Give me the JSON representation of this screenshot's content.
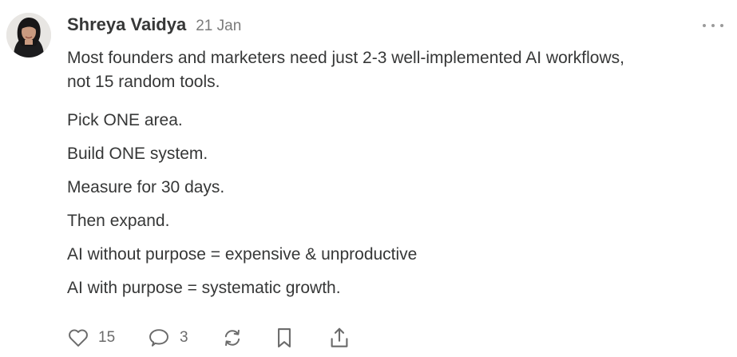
{
  "post": {
    "author": "Shreya Vaidya",
    "date": "21 Jan",
    "paragraphs": [
      "Most founders and marketers need just 2-3 well-implemented AI workflows,",
      "not 15 random tools.",
      "Pick ONE area.",
      "Build ONE system.",
      "Measure for 30 days.",
      "Then expand.",
      "AI without purpose = expensive & unproductive",
      "AI with purpose = systematic growth."
    ]
  },
  "actions": {
    "likes": "15",
    "comments": "3"
  },
  "icons": {
    "more": "more-horizontal-icon",
    "like": "heart-icon",
    "comment": "speech-bubble-icon",
    "restack": "restack-icon",
    "save": "bookmark-icon",
    "share": "share-icon"
  },
  "colors": {
    "text": "#363737",
    "muted": "#7b7b7b",
    "icon": "#6b6b6b"
  }
}
